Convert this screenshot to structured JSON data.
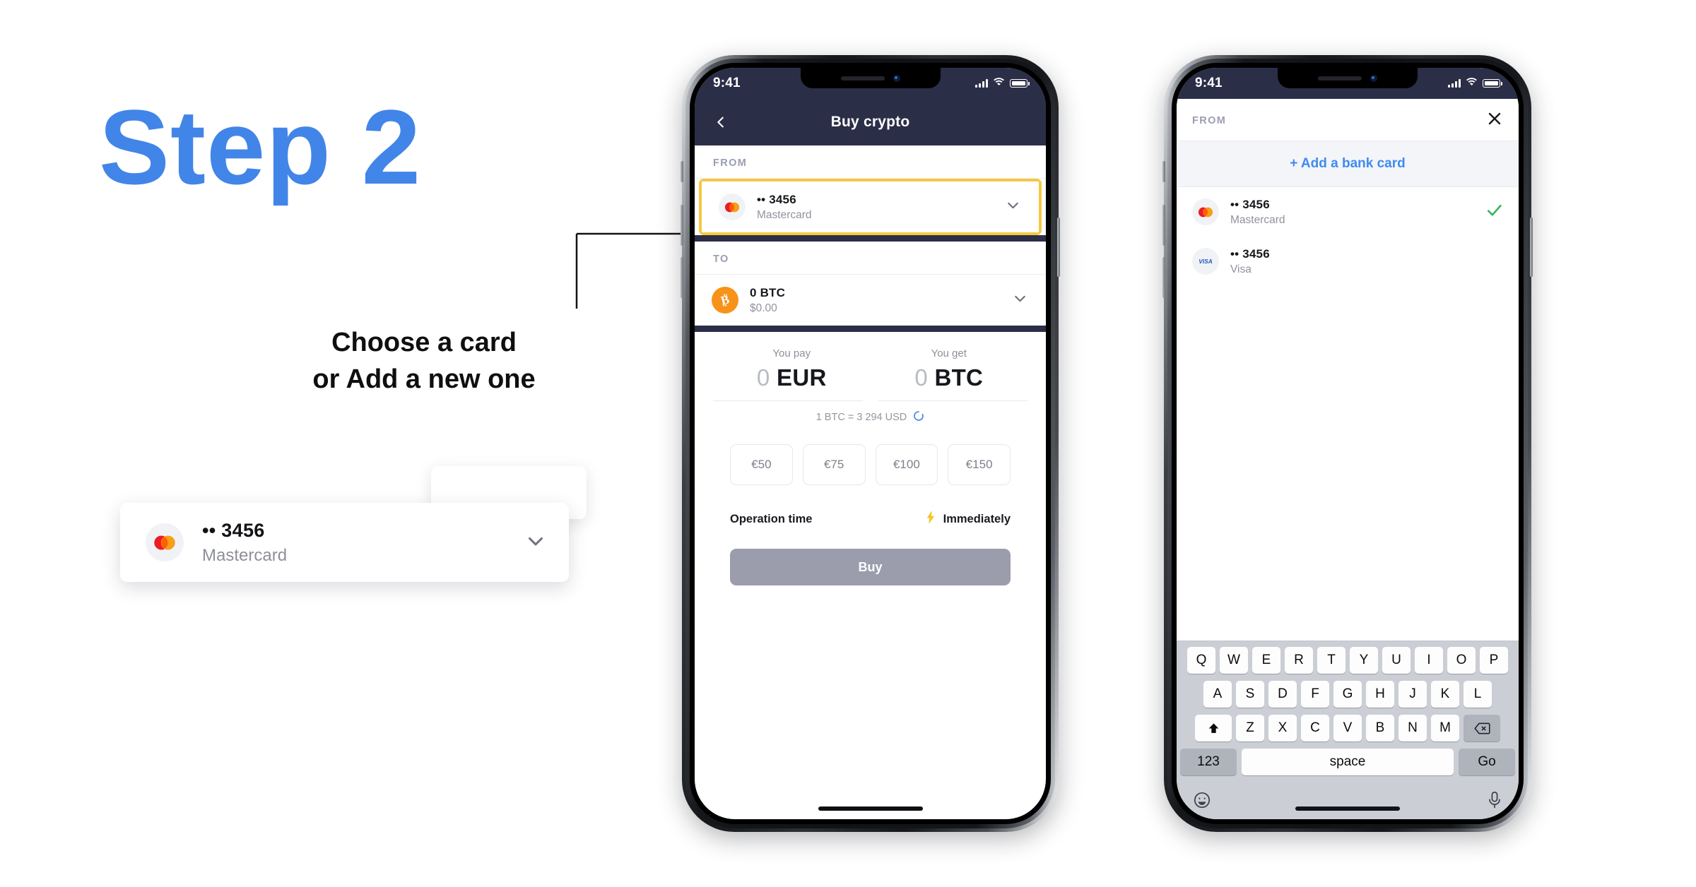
{
  "annotation": {
    "step_title": "Step 2",
    "callout_line1": "Choose a card",
    "callout_line2": "or Add a new one",
    "accent_blue": "#4285e8",
    "highlight_yellow": "#f5c842"
  },
  "zoom_callout": {
    "card_number": "•• 3456",
    "card_brand": "Mastercard",
    "brand_icon": "mastercard-logo-icon",
    "chevron_icon": "chevron-down-icon"
  },
  "phone1": {
    "status_bar": {
      "time": "9:41",
      "signal_icon": "cellular-bars-icon",
      "wifi_icon": "wifi-icon",
      "battery_icon": "battery-full-icon"
    },
    "navbar": {
      "back_icon": "chevron-left-icon",
      "title": "Buy crypto"
    },
    "from_section": {
      "label": "FROM",
      "card_number": "•• 3456",
      "card_brand": "Mastercard",
      "brand_icon": "mastercard-logo-icon",
      "chevron_icon": "chevron-down-icon",
      "highlighted": true
    },
    "to_section": {
      "label": "TO",
      "asset_amount": "0 BTC",
      "asset_fiat": "$0.00",
      "asset_icon": "bitcoin-logo-icon",
      "chevron_icon": "chevron-down-icon"
    },
    "quote": {
      "pay_label": "You pay",
      "pay_zero": "0",
      "pay_currency": "EUR",
      "get_label": "You get",
      "get_zero": "0",
      "get_currency": "BTC",
      "rate_text": "1 BTC = 3 294 USD",
      "spinner_icon": "loading-spinner-icon"
    },
    "quick_amounts": [
      "€50",
      "€75",
      "€100",
      "€150"
    ],
    "operation": {
      "label": "Operation time",
      "value": "Immediately",
      "bolt_icon": "lightning-bolt-icon"
    },
    "primary_button": "Buy",
    "home_indicator_icon": "home-indicator-icon"
  },
  "phone2": {
    "status_bar": {
      "time": "9:41",
      "signal_icon": "cellular-bars-icon",
      "wifi_icon": "wifi-icon",
      "battery_icon": "battery-full-icon"
    },
    "sheet": {
      "label": "FROM",
      "close_icon": "close-x-icon",
      "add_card_label": "+ Add a bank card"
    },
    "cards": [
      {
        "number": "•• 3456",
        "brand": "Mastercard",
        "brand_icon": "mastercard-logo-icon",
        "selected": true,
        "check_icon": "checkmark-icon"
      },
      {
        "number": "•• 3456",
        "brand": "Visa",
        "brand_icon": "visa-logo-icon",
        "selected": false,
        "check_icon": ""
      }
    ],
    "keyboard": {
      "row1": [
        "Q",
        "W",
        "E",
        "R",
        "T",
        "Y",
        "U",
        "I",
        "O",
        "P"
      ],
      "row2": [
        "A",
        "S",
        "D",
        "F",
        "G",
        "H",
        "J",
        "K",
        "L"
      ],
      "row3": [
        "Z",
        "X",
        "C",
        "V",
        "B",
        "N",
        "M"
      ],
      "shift_icon": "shift-arrow-icon",
      "backspace_icon": "backspace-delete-icon",
      "numeric_label": "123",
      "space_label": "space",
      "go_label": "Go",
      "emoji_icon": "emoji-smiley-icon",
      "mic_icon": "microphone-icon"
    },
    "home_indicator_icon": "home-indicator-icon"
  }
}
